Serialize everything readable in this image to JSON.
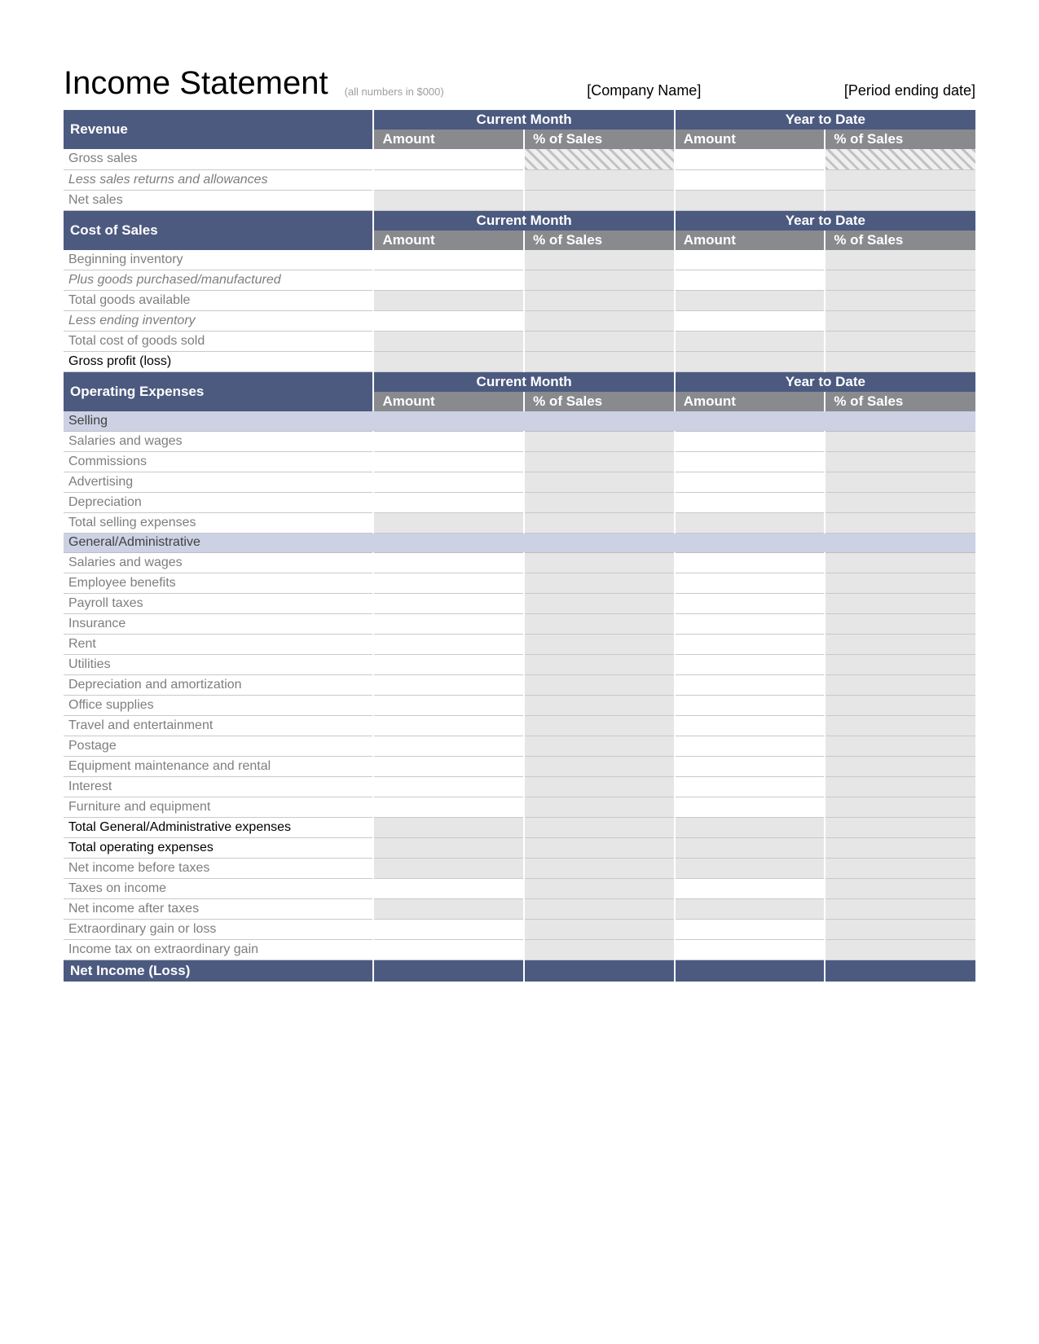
{
  "header": {
    "title": "Income Statement",
    "note": "(all numbers in $000)",
    "company": "[Company Name]",
    "period": "[Period ending date]"
  },
  "periods": {
    "p1": "Current Month",
    "p2": "Year to Date"
  },
  "columns": {
    "amount": "Amount",
    "pct": "% of Sales"
  },
  "sections": {
    "revenue": "Revenue",
    "cost_of_sales": "Cost of Sales",
    "operating_expenses": "Operating Expenses"
  },
  "subsections": {
    "selling": "Selling",
    "general_admin": "General/Administrative"
  },
  "rows": {
    "gross_sales": "Gross sales",
    "less_returns": "Less sales returns and allowances",
    "net_sales": "Net sales",
    "beg_inv": "Beginning inventory",
    "plus_goods": "Plus goods purchased/manufactured",
    "total_goods": "Total goods available",
    "less_ending_inv": "Less ending inventory",
    "total_cogs": "Total cost of goods sold",
    "gross_profit": "Gross profit (loss)",
    "sell_salaries": "Salaries and wages",
    "sell_commissions": "Commissions",
    "sell_advertising": "Advertising",
    "sell_depreciation": "Depreciation",
    "sell_total": "Total selling expenses",
    "ga_salaries": "Salaries and wages",
    "ga_benefits": "Employee benefits",
    "ga_payroll": "Payroll taxes",
    "ga_insurance": "Insurance",
    "ga_rent": "Rent",
    "ga_utilities": "Utilities",
    "ga_dep_amort": "Depreciation and amortization",
    "ga_office": "Office supplies",
    "ga_travel": "Travel and entertainment",
    "ga_postage": "Postage",
    "ga_equip": "Equipment maintenance and rental",
    "ga_interest": "Interest",
    "ga_furniture": "Furniture and equipment",
    "ga_total": "Total General/Administrative expenses",
    "total_opex": "Total operating expenses",
    "ni_before_tax": "Net income before taxes",
    "taxes": "Taxes on income",
    "ni_after_tax": "Net income after taxes",
    "extraordinary": "Extraordinary gain or loss",
    "tax_extraordinary": "Income tax on extraordinary gain",
    "net_income": "Net Income (Loss)"
  }
}
